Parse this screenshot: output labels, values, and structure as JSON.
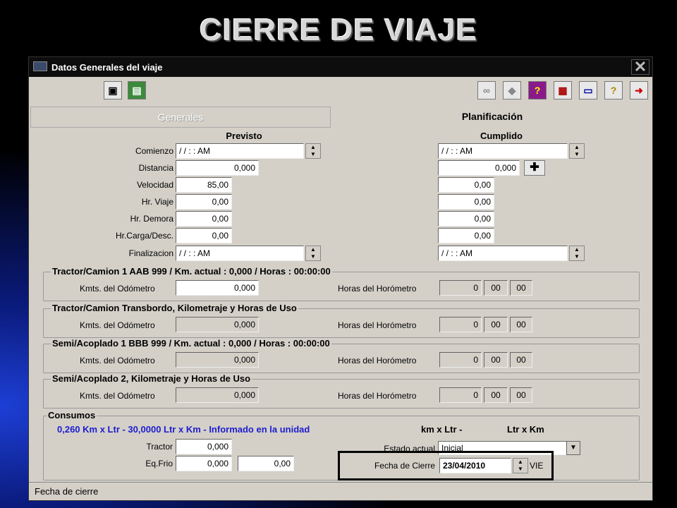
{
  "slide_title": "CIERRE DE VIAJE",
  "window": {
    "title": "Datos Generales del viaje",
    "close": "✕"
  },
  "toolbar": {
    "left_icons": [
      "save-icon",
      "monitor-icon"
    ],
    "right_icons": [
      "binoculars-icon",
      "tag-icon",
      "help-box-icon",
      "grid-icon",
      "calculator-icon",
      "question-icon",
      "exit-icon"
    ]
  },
  "tabs": {
    "generales": "Generales",
    "planificacion": "Planificación"
  },
  "previsto": {
    "header": "Previsto",
    "comienzo": "  / /     :  :  AM",
    "distancia": "0,000",
    "velocidad": "85,00",
    "hr_viaje": "0,00",
    "hr_demora": "0,00",
    "hr_carga": "0,00",
    "finalizacion": "  / /     :  :  AM"
  },
  "cumplido": {
    "header": "Cumplido",
    "comienzo": "  / /     :  :  AM",
    "distancia": "0,000",
    "velocidad": "0,00",
    "hr_viaje": "0,00",
    "hr_demora": "0,00",
    "hr_carga": "0,00",
    "finalizacion": "  / /     :  :  AM"
  },
  "labels": {
    "comienzo": "Comienzo",
    "distancia": "Distancia",
    "velocidad": "Velocidad",
    "hr_viaje": "Hr. Viaje",
    "hr_demora": "Hr. Demora",
    "hr_carga": "Hr.Carga/Desc.",
    "finalizacion": "Finalizacion",
    "kmts": "Kmts. del Odómetro",
    "horas": "Horas del Horómetro"
  },
  "groups": [
    {
      "title": "Tractor/Camion 1 AAB 999   /   Km. actual : 0,000   /   Horas : 00:00:00",
      "kmts": "0,000",
      "h": "0",
      "m": "00",
      "s": "00",
      "gray": false
    },
    {
      "title": "Tractor/Camion Transbordo, Kilometraje y Horas de Uso",
      "kmts": "0,000",
      "h": "0",
      "m": "00",
      "s": "00",
      "gray": true
    },
    {
      "title": "Semi/Acoplado 1 BBB 999   /   Km. actual : 0,000   /   Horas : 00:00:00",
      "kmts": "0,000",
      "h": "0",
      "m": "00",
      "s": "00",
      "gray": true
    },
    {
      "title": "Semi/Acoplado 2, Kilometraje y Horas de Uso",
      "kmts": "0,000",
      "h": "0",
      "m": "00",
      "s": "00",
      "gray": true
    }
  ],
  "consumos": {
    "title": "Consumos",
    "info": "0,260 Km x Ltr  -  30,0000 Ltr x Km - Informado en la unidad",
    "km_x_ltr": "km x Ltr  -",
    "ltr_x_km": "Ltr x Km",
    "tractor_label": "Tractor",
    "tractor_value": "0,000",
    "eqfrio_label": "Eq.Frio",
    "eqfrio_value1": "0,000",
    "eqfrio_value2": "0,00",
    "estado_label": "Estado actual",
    "estado_value": "Inicial",
    "fecha_label": "Fecha de Cierre",
    "fecha_value": "23/04/2010",
    "dia": "VIE"
  },
  "status": "Fecha de cierre"
}
